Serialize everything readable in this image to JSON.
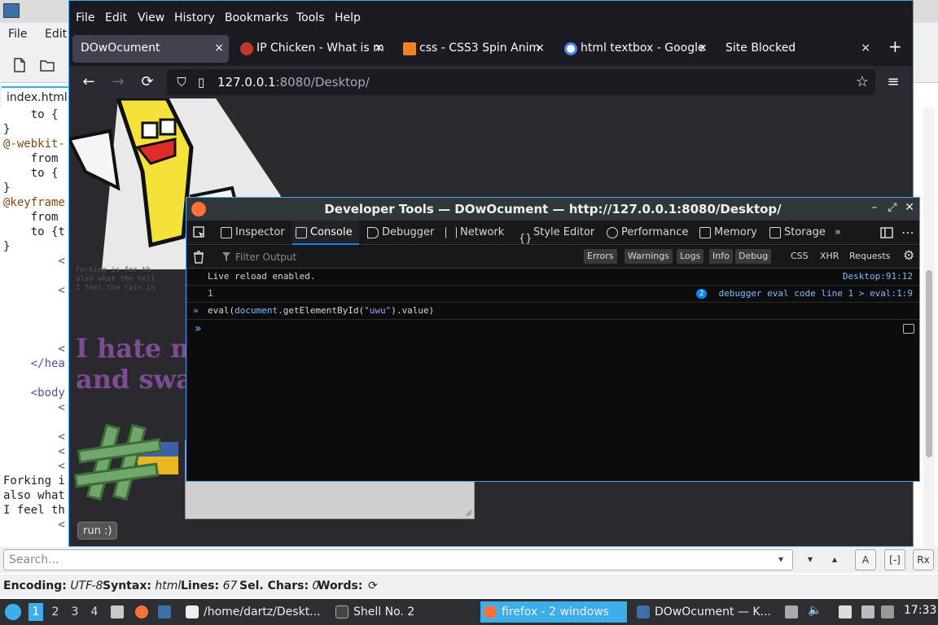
{
  "editor": {
    "menu": [
      "File",
      "Edit"
    ],
    "tab_label": "index.html",
    "code_lines": [
      {
        "text": "    to {",
        "cls": ""
      },
      {
        "text": "}",
        "cls": ""
      },
      {
        "text": "@-webkit-",
        "cls": "kw-at"
      },
      {
        "text": "    from ",
        "cls": ""
      },
      {
        "text": "    to {",
        "cls": ""
      },
      {
        "text": "}",
        "cls": ""
      },
      {
        "text": "@keyframe",
        "cls": "kw-at"
      },
      {
        "text": "    from ",
        "cls": ""
      },
      {
        "text": "    to {t",
        "cls": ""
      },
      {
        "text": "}",
        "cls": ""
      },
      {
        "text": "        <",
        "cls": "tag"
      },
      {
        "text": "",
        "cls": ""
      },
      {
        "text": "        <",
        "cls": "tag"
      },
      {
        "text": "",
        "cls": ""
      },
      {
        "text": "",
        "cls": ""
      },
      {
        "text": "",
        "cls": ""
      },
      {
        "text": "        <",
        "cls": "tag"
      },
      {
        "text": "    </hea",
        "cls": "tag"
      },
      {
        "text": "",
        "cls": ""
      },
      {
        "text": "    <body",
        "cls": "tag"
      },
      {
        "text": "        <",
        "cls": "tag"
      },
      {
        "text": "",
        "cls": ""
      },
      {
        "text": "        <",
        "cls": "tag"
      },
      {
        "text": "        <",
        "cls": "tag"
      },
      {
        "text": "        <",
        "cls": "tag"
      },
      {
        "text": "Forking i",
        "cls": ""
      },
      {
        "text": "also what",
        "cls": ""
      },
      {
        "text": "I feel th",
        "cls": ""
      },
      {
        "text": "        <",
        "cls": "tag"
      }
    ],
    "search_placeholder": "Search...",
    "search_buttons": [
      "A",
      "[-]",
      "Rx"
    ],
    "status": {
      "encoding_label": "Encoding:",
      "encoding_value": "UTF-8",
      "syntax_label": "Syntax:",
      "syntax_value": "html",
      "lines_label": "Lines:",
      "lines_value": "67",
      "selchars_label": "Sel. Chars:",
      "selchars_value": "0",
      "words_label": "Words:",
      "refresh_glyph": "⟳"
    }
  },
  "firefox": {
    "menu": [
      "File",
      "Edit",
      "View",
      "History",
      "Bookmarks",
      "Tools",
      "Help"
    ],
    "tabs": [
      {
        "label": "DOwOcument",
        "active": true,
        "favicon_color": ""
      },
      {
        "label": "IP Chicken - What is m",
        "active": false,
        "favicon_color": "#c0392b"
      },
      {
        "label": "css - CSS3 Spin Anim",
        "active": false,
        "favicon_color": "#f48024"
      },
      {
        "label": "html textbox - Google",
        "active": false,
        "favicon_color": "#4285f4"
      },
      {
        "label": "Site Blocked",
        "active": false,
        "favicon_color": ""
      }
    ],
    "tab_close_glyph": "×",
    "newtab_glyph": "+",
    "nav": {
      "back": "←",
      "forward": "→",
      "reload": "⟳",
      "shield": "⛉",
      "page": "▯",
      "star": "☆",
      "menu": "≡"
    },
    "url_host": "127.0.0.1",
    "url_path": ":8080/Desktop/",
    "page": {
      "small_text": "Forking is for th\nalso what the hell\nI feel the rain in",
      "heading": "I hate m\nand swa",
      "run_button": "run :)"
    }
  },
  "devtools": {
    "title": "Developer Tools — DOwOcument — http://127.0.0.1:8080/Desktop/",
    "controls": {
      "min": "–",
      "max": "⤢",
      "close": "✕"
    },
    "tools": [
      {
        "label": "Inspector",
        "active": false
      },
      {
        "label": "Console",
        "active": true
      },
      {
        "label": "Debugger",
        "active": false
      },
      {
        "label": "Network",
        "active": false
      },
      {
        "label": "Style Editor",
        "active": false
      },
      {
        "label": "Performance",
        "active": false
      },
      {
        "label": "Memory",
        "active": false
      },
      {
        "label": "Storage",
        "active": false
      }
    ],
    "more_glyph": "»",
    "kebab_glyph": "⋯",
    "filter_placeholder": "Filter Output",
    "filter_levels": [
      "Errors",
      "Warnings",
      "Logs",
      "Info",
      "Debug"
    ],
    "filter_types": [
      "CSS",
      "XHR",
      "Requests"
    ],
    "messages": [
      {
        "text": "Live reload enabled.",
        "source": "Desktop:91:12",
        "badge": ""
      },
      {
        "text": "1",
        "source": "debugger eval code line 1 > eval:1:9",
        "badge": "2"
      }
    ],
    "command": {
      "prefix": "eval(",
      "obj": "document",
      "method": ".getElementById(",
      "arg": "\"uwu\"",
      "suffix": ").value)"
    },
    "prompt_glyph": "»"
  },
  "taskbar": {
    "desktops": [
      "1",
      "2",
      "3",
      "4"
    ],
    "items": [
      {
        "label": "/home/dartz/Deskt...",
        "active": false,
        "icon_color": "#eee"
      },
      {
        "label": "Shell No. 2",
        "active": false,
        "icon_color": "#444"
      },
      {
        "label": "firefox - 2 windows",
        "active": true,
        "icon_color": "#ff7139"
      },
      {
        "label": "DOwOcument — K...",
        "active": false,
        "icon_color": "#3d6fa8"
      }
    ],
    "clock": "17:33"
  }
}
